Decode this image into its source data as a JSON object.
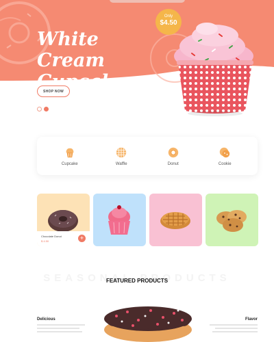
{
  "hero": {
    "title": "White Cream Cupcake",
    "badge_small": "Only",
    "badge_price": "$4.50",
    "shop_button": "SHOP NOW",
    "colors": {
      "background": "#f58a72",
      "accent": "#f07a64",
      "badge": "#f5b64a"
    }
  },
  "slider": {
    "dots": [
      "inactive",
      "active"
    ]
  },
  "categories": [
    {
      "label": "Cupcake",
      "icon": "cupcake-icon"
    },
    {
      "label": "Waffle",
      "icon": "waffle-icon"
    },
    {
      "label": "Donut",
      "icon": "donut-icon"
    },
    {
      "label": "Cookie",
      "icon": "cookie-icon"
    }
  ],
  "products": [
    {
      "name": "Chocolate Donut",
      "price": "$ 4.50",
      "bg": "#fde2b6"
    },
    {
      "bg": "#bfe1fb"
    },
    {
      "bg": "#f9c1d3"
    },
    {
      "bg": "#cff3b6"
    }
  ],
  "featured": {
    "heading": "FEATURED PRODUCTS",
    "watermark": "SEASONAL PRODUCTS",
    "left_title": "Delicious",
    "right_title": "Flavor"
  }
}
